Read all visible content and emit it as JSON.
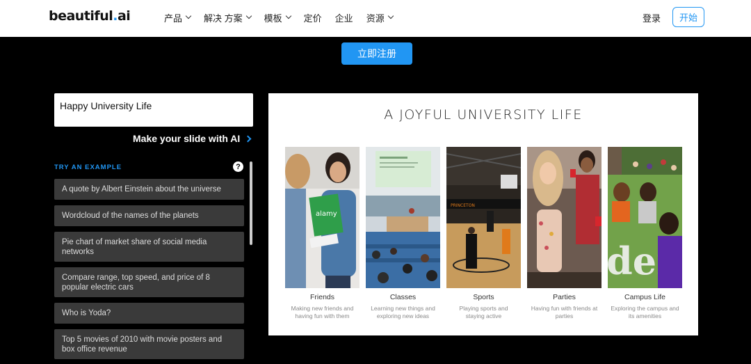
{
  "header": {
    "logo_main": "beautiful",
    "logo_dot": ".",
    "logo_suffix": "ai",
    "nav": [
      {
        "label": "产品",
        "dropdown": true
      },
      {
        "label": "解决 方案",
        "dropdown": true
      },
      {
        "label": "模板",
        "dropdown": true
      },
      {
        "label": "定价",
        "dropdown": false
      },
      {
        "label": "企业",
        "dropdown": false
      },
      {
        "label": "资源",
        "dropdown": true
      }
    ],
    "login_label": "登录",
    "start_label": "开始"
  },
  "signup_label": "立即注册",
  "prompt": {
    "value": "Happy University Life",
    "make_slide_label": "Make your slide with AI"
  },
  "examples": {
    "heading": "TRY AN EXAMPLE",
    "help": "?",
    "items": [
      "A quote by Albert Einstein about the universe",
      "Wordcloud of the names of the planets",
      "Pie chart of market share of social media networks",
      "Compare range, top speed, and price of 8 popular electric cars",
      "Who is Yoda?",
      "Top 5 movies of 2010 with movie posters and box office revenue"
    ]
  },
  "slide": {
    "title": "A JOYFUL UNIVERSITY LIFE",
    "columns": [
      {
        "title": "Friends",
        "desc": "Making new friends and having fun with them"
      },
      {
        "title": "Classes",
        "desc": "Learning new things and exploring new ideas"
      },
      {
        "title": "Sports",
        "desc": "Playing sports and staying active"
      },
      {
        "title": "Parties",
        "desc": "Having fun with friends at parties"
      },
      {
        "title": "Campus Life",
        "desc": "Exploring the campus and its amenities"
      }
    ],
    "photo_texts": {
      "friends_book": "alamy",
      "sports_banner": "PRINCETON",
      "campus_overlay": "den"
    }
  },
  "colors": {
    "accent": "#2196f3",
    "background": "#000000",
    "example_bg": "#3a3a3a"
  }
}
